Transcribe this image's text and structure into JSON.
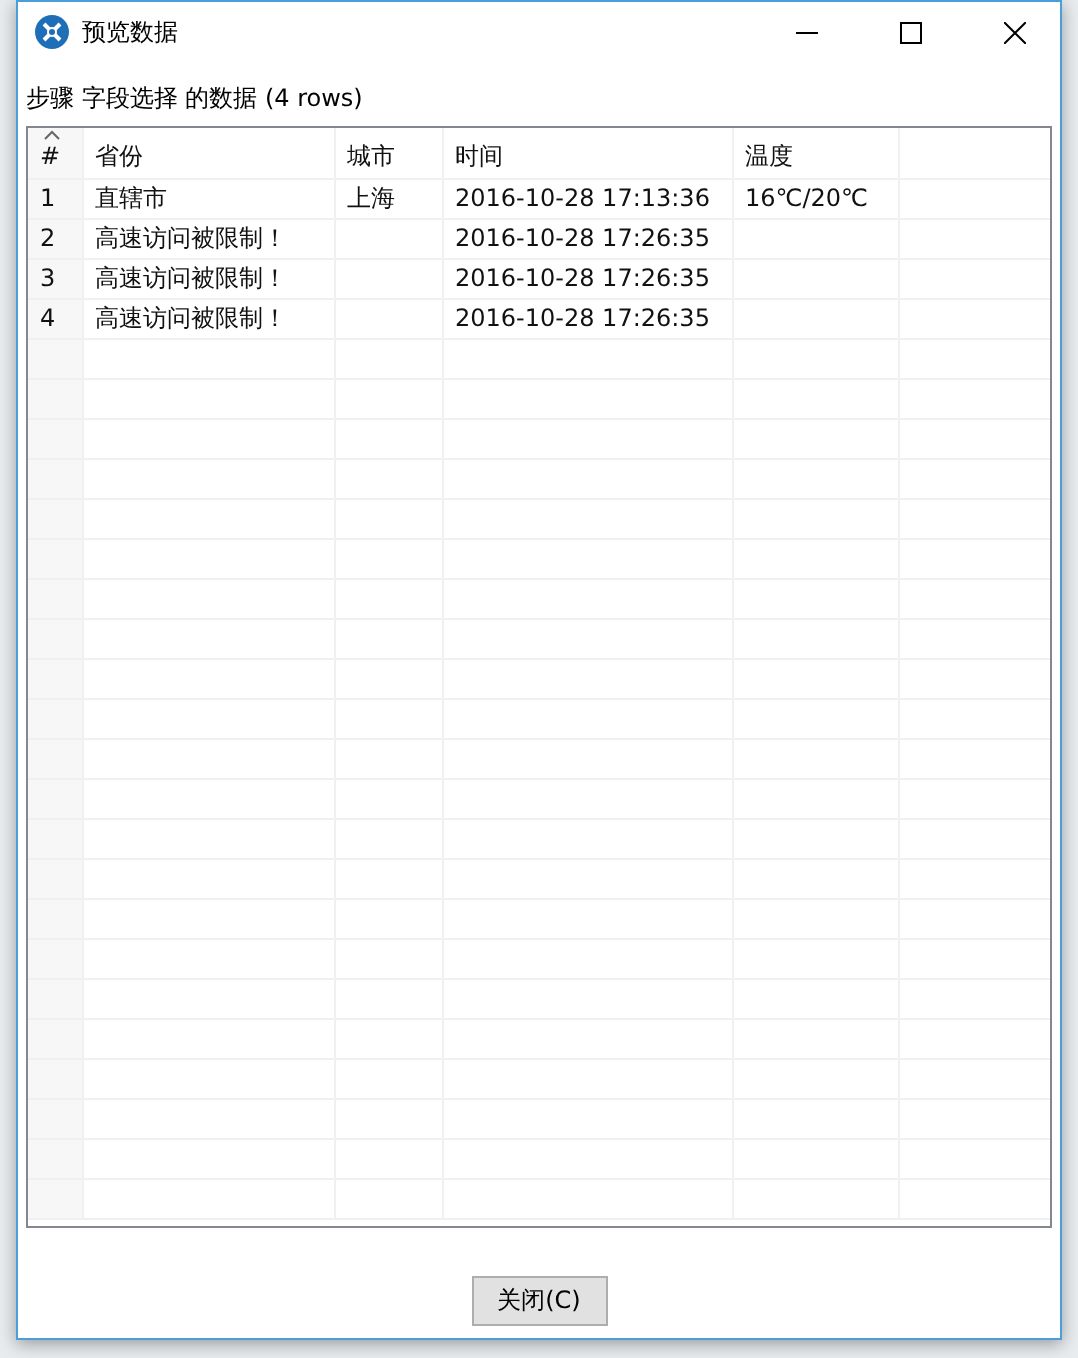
{
  "window": {
    "title": "预览数据"
  },
  "caption": "步骤 字段选择 的数据  (4 rows)",
  "table": {
    "columns": [
      "#",
      "省份",
      "城市",
      "时间",
      "温度"
    ],
    "rows": [
      [
        "1",
        "直辖市",
        "上海",
        "2016-10-28 17:13:36",
        "16℃/20℃"
      ],
      [
        "2",
        "高速访问被限制！",
        "",
        "2016-10-28 17:26:35",
        ""
      ],
      [
        "3",
        "高速访问被限制！",
        "",
        "2016-10-28 17:26:35",
        ""
      ],
      [
        "4",
        "高速访问被限制！",
        "",
        "2016-10-28 17:26:35",
        ""
      ]
    ]
  },
  "buttons": [
    "关闭(C)"
  ]
}
